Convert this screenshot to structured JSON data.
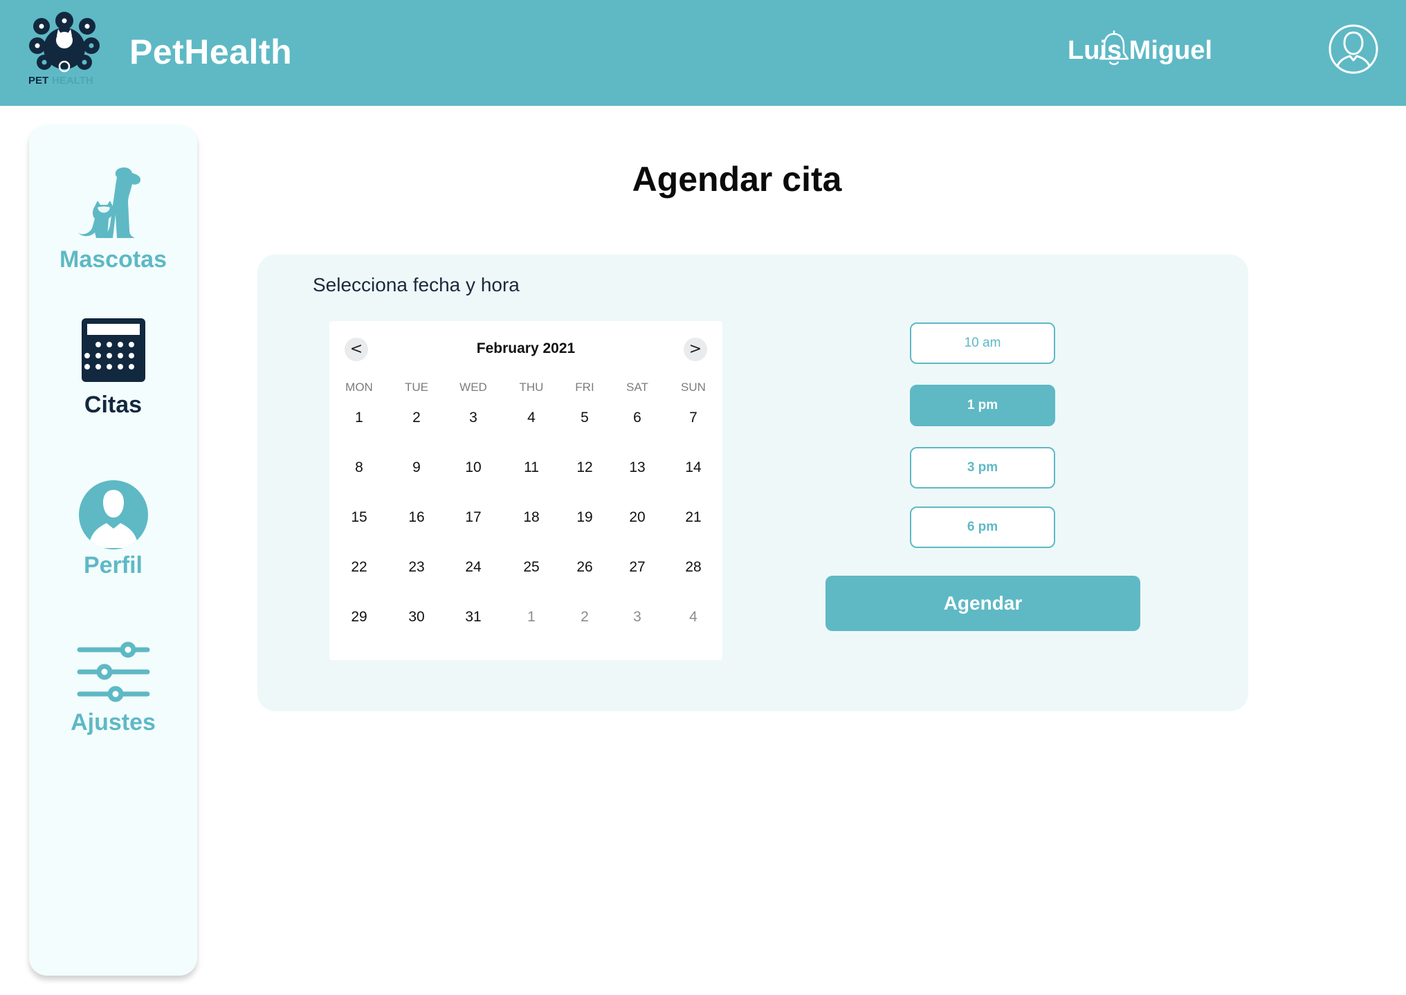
{
  "header": {
    "logo_text": "PETHEALTH",
    "app_name": "PetHealth",
    "user_name": "Luis Miguel",
    "icons": [
      "bell-icon",
      "user-avatar-icon"
    ],
    "color": "#5eb9c5"
  },
  "sidebar": {
    "items": [
      {
        "label": "Mascotas",
        "icon": "pets-icon",
        "active": false
      },
      {
        "label": "Citas",
        "icon": "calendar-icon",
        "active": true
      },
      {
        "label": "Perfil",
        "icon": "profile-icon",
        "active": false
      },
      {
        "label": "Ajustes",
        "icon": "sliders-icon",
        "active": false
      }
    ],
    "active_color": "#12283f"
  },
  "main": {
    "title": "Agendar cita",
    "panel_heading": "Selecciona fecha y hora",
    "calendar": {
      "month_label": "February 2021",
      "prev": "<",
      "next": ">",
      "weekdays": [
        "MON",
        "TUE",
        "WED",
        "THU",
        "FRI",
        "SAT",
        "SUN"
      ],
      "weeks": [
        [
          "1",
          "2",
          "3",
          "4",
          "5",
          "6",
          "7"
        ],
        [
          "8",
          "9",
          "10",
          "11",
          "12",
          "13",
          "14"
        ],
        [
          "15",
          "16",
          "17",
          "18",
          "19",
          "20",
          "21"
        ],
        [
          "22",
          "23",
          "24",
          "25",
          "26",
          "27",
          "28"
        ],
        [
          "29",
          "30",
          "31",
          "1",
          "2",
          "3",
          "4"
        ]
      ],
      "outside_month_in_last_week_from_index": 3
    },
    "time_slots": [
      {
        "label": "10 am",
        "selected": false
      },
      {
        "label": "1 pm",
        "selected": true
      },
      {
        "label": "3 pm",
        "selected": false
      },
      {
        "label": "6 pm",
        "selected": false
      }
    ],
    "submit_label": "Agendar"
  }
}
